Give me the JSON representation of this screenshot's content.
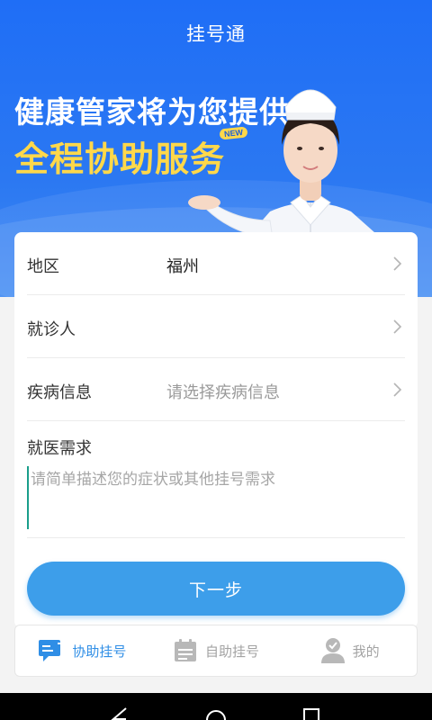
{
  "header": {
    "title": "挂号通"
  },
  "banner": {
    "line1": "健康管家将为您提供",
    "line2": "全程协助服务",
    "badge": "NEW"
  },
  "form": {
    "region": {
      "label": "地区",
      "value": "福州"
    },
    "patient": {
      "label": "就诊人",
      "value": ""
    },
    "disease": {
      "label": "疾病信息",
      "placeholder": "请选择疾病信息"
    },
    "need": {
      "label": "就医需求",
      "placeholder": "请简单描述您的症状或其他挂号需求"
    },
    "next_label": "下一步"
  },
  "tabs": [
    {
      "label": "协助挂号",
      "icon": "chat-icon",
      "active": true
    },
    {
      "label": "自助挂号",
      "icon": "calendar-icon",
      "active": false
    },
    {
      "label": "我的",
      "icon": "user-icon",
      "active": false
    }
  ],
  "colors": {
    "primary_blue": "#2b78f2",
    "banner_yellow": "#ffd84a",
    "button_blue": "#3d9eea",
    "active_tab": "#2f8ee6"
  }
}
